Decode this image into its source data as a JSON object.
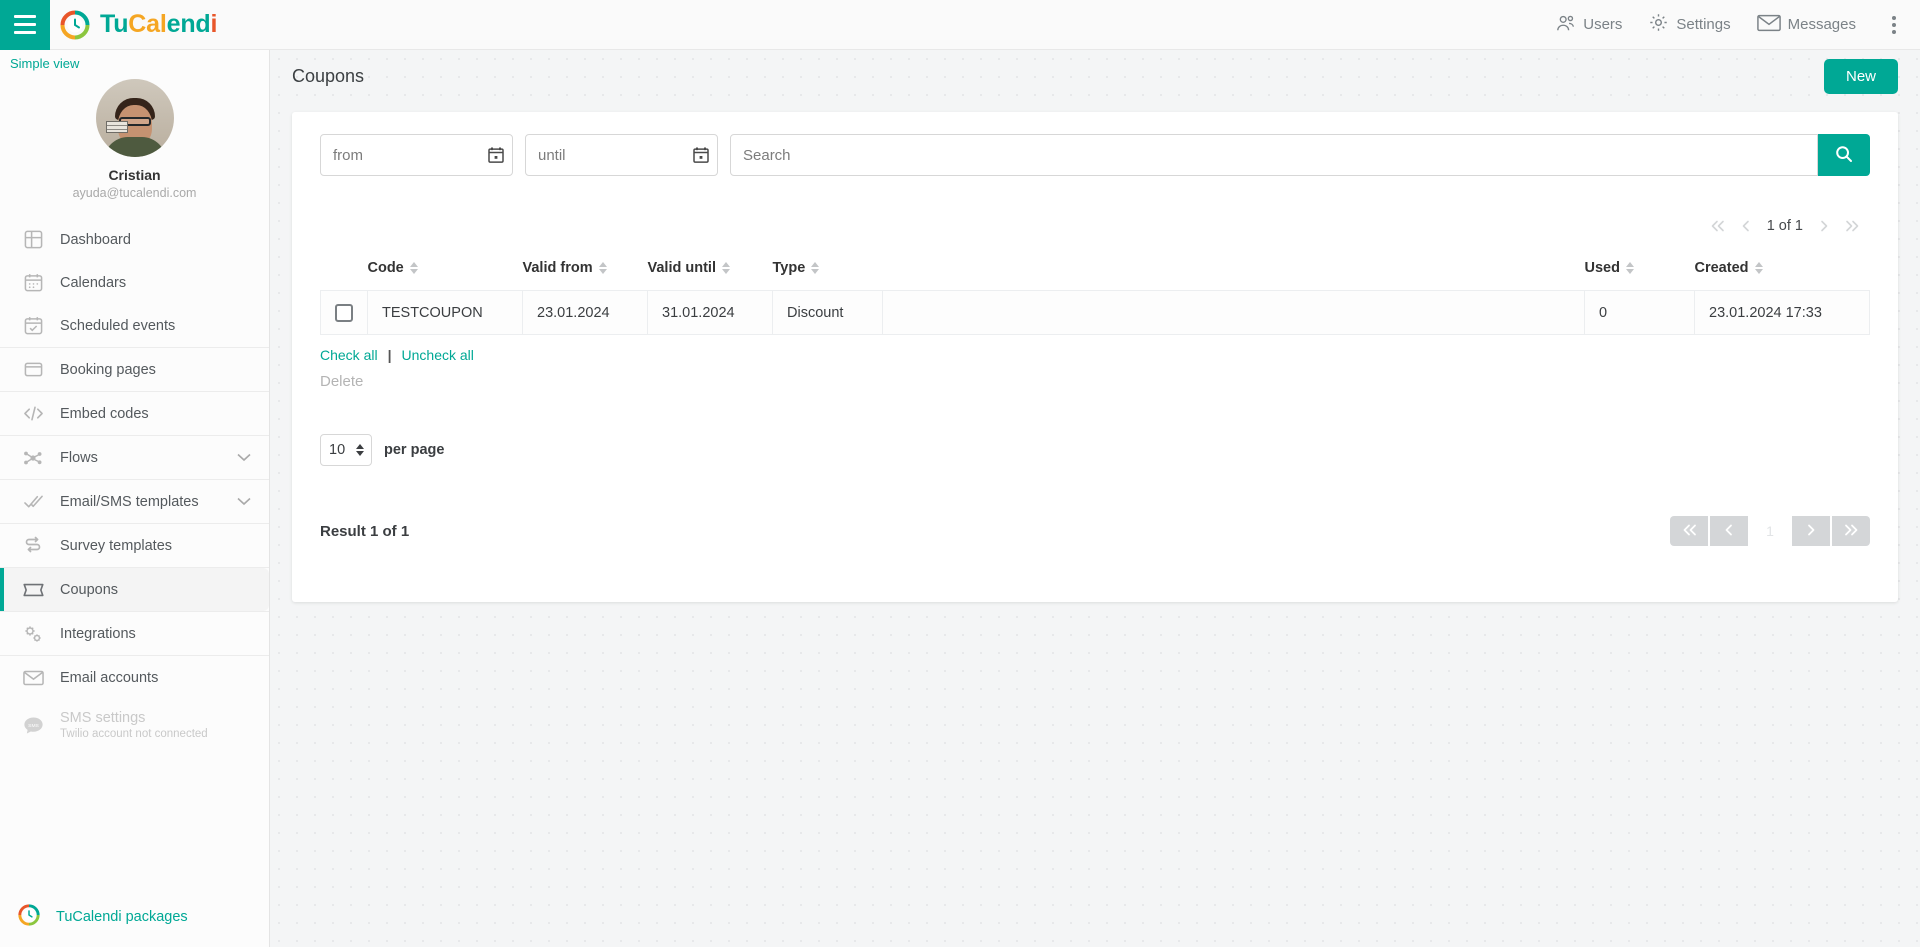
{
  "brand": {
    "tu": "Tu",
    "cal": "Cal",
    "end": "end",
    "i": "i",
    "logo_icon": "tucalendi-logo-icon",
    "menu_icon": "hamburger-menu-icon"
  },
  "topbar": {
    "users": "Users",
    "settings": "Settings",
    "messages": "Messages",
    "users_icon": "users-icon",
    "settings_icon": "gear-icon",
    "messages_icon": "envelope-icon",
    "more_icon": "kebab-menu-icon"
  },
  "sidebar": {
    "simple_view": "Simple view",
    "profile": {
      "name": "Cristian",
      "email": "ayuda@tucalendi.com",
      "avatar_icon": "user-avatar"
    },
    "items": [
      {
        "label": "Dashboard",
        "icon": "dashboard-grid-icon",
        "group": 0
      },
      {
        "label": "Calendars",
        "icon": "calendar-icon",
        "group": 0
      },
      {
        "label": "Scheduled events",
        "icon": "calendar-check-icon",
        "group": 0
      },
      {
        "label": "Booking pages",
        "icon": "window-icon",
        "group": 1
      },
      {
        "label": "Embed codes",
        "icon": "code-brackets-icon",
        "group": 2
      },
      {
        "label": "Flows",
        "icon": "flow-nodes-icon",
        "group": 3,
        "chevron": true
      },
      {
        "label": "Email/SMS templates",
        "icon": "double-check-icon",
        "group": 4,
        "chevron": true
      },
      {
        "label": "Survey templates",
        "icon": "survey-arrows-icon",
        "group": 5
      },
      {
        "label": "Coupons",
        "icon": "ticket-icon",
        "group": 6,
        "active": true
      },
      {
        "label": "Integrations",
        "icon": "gears-icon",
        "group": 7
      },
      {
        "label": "Email accounts",
        "icon": "envelope-icon",
        "group": 8
      },
      {
        "label": "SMS settings",
        "sub": "Twilio account not connected",
        "icon": "sms-bubble-icon",
        "group": 8,
        "disabled": true
      }
    ],
    "packages": {
      "label": "TuCalendi packages",
      "icon": "tucalendi-logo-icon"
    }
  },
  "page": {
    "title": "Coupons",
    "new_button": "New"
  },
  "filters": {
    "from_placeholder": "from",
    "from_value": "",
    "until_placeholder": "until",
    "until_value": "",
    "search_placeholder": "Search",
    "search_value": "",
    "calendar_icon": "calendar-picker-icon",
    "search_icon": "search-icon"
  },
  "pager_top": {
    "label": "1 of 1",
    "first_icon": "chevron-double-left-icon",
    "prev_icon": "chevron-left-icon",
    "next_icon": "chevron-right-icon",
    "last_icon": "chevron-double-right-icon"
  },
  "table": {
    "columns": [
      "Code",
      "Valid from",
      "Valid until",
      "Type",
      "",
      "Used",
      "Created"
    ],
    "rows": [
      {
        "checked": false,
        "code": "TESTCOUPON",
        "valid_from": "23.01.2024",
        "valid_until": "31.01.2024",
        "type": "Discount",
        "blank": "",
        "used": "0",
        "created": "23.01.2024 17:33"
      }
    ]
  },
  "actions": {
    "check_all": "Check all",
    "separator": "|",
    "uncheck_all": "Uncheck all",
    "delete": "Delete"
  },
  "perpage": {
    "value": "10",
    "label": "per page"
  },
  "footer": {
    "result": "Result 1 of 1",
    "page_number": "1"
  },
  "colors": {
    "accent": "#00a895",
    "orange": "#f5a623",
    "red": "#e8562a",
    "page_bg": "#f4f5f6"
  }
}
